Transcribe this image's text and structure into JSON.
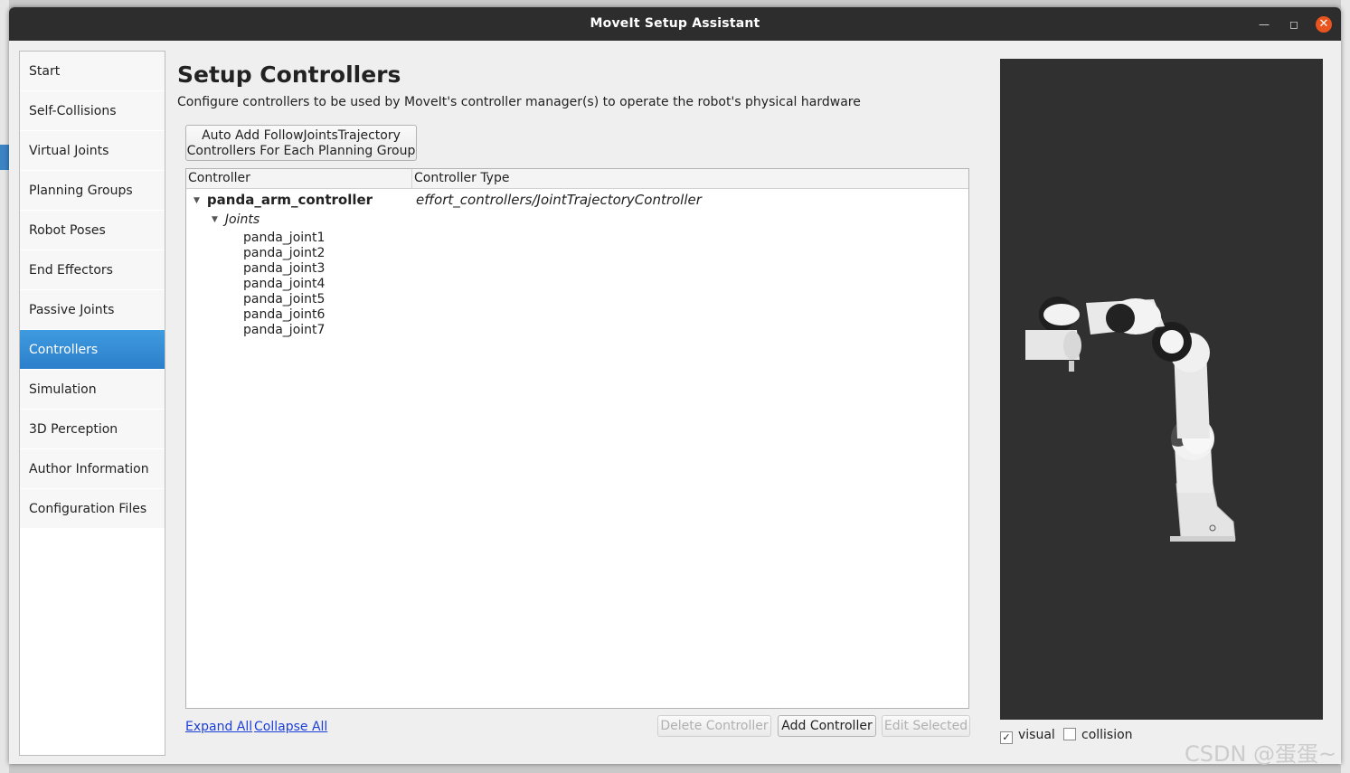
{
  "window": {
    "title": "MoveIt Setup Assistant"
  },
  "titlebar_icons": {
    "minimize": "minimize-icon",
    "maximize": "maximize-icon",
    "close": "close-icon"
  },
  "sidebar": {
    "items": [
      {
        "label": "Start"
      },
      {
        "label": "Self-Collisions"
      },
      {
        "label": "Virtual Joints"
      },
      {
        "label": "Planning Groups"
      },
      {
        "label": "Robot Poses"
      },
      {
        "label": "End Effectors"
      },
      {
        "label": "Passive Joints"
      },
      {
        "label": "Controllers"
      },
      {
        "label": "Simulation"
      },
      {
        "label": "3D Perception"
      },
      {
        "label": "Author Information"
      },
      {
        "label": "Configuration Files"
      }
    ],
    "active": "Controllers"
  },
  "main": {
    "title": "Setup Controllers",
    "description": "Configure controllers to be used by MoveIt's controller manager(s) to operate the robot's physical hardware",
    "auto_add_button": {
      "line1": "Auto Add FollowJointsTrajectory",
      "line2": "Controllers For Each Planning Group"
    },
    "tree": {
      "columns": [
        "Controller",
        "Controller Type"
      ],
      "controller": {
        "name": "panda_arm_controller",
        "type": "effort_controllers/JointTrajectoryController"
      },
      "joints_label": "Joints",
      "joints": [
        "panda_joint1",
        "panda_joint2",
        "panda_joint3",
        "panda_joint4",
        "panda_joint5",
        "panda_joint6",
        "panda_joint7"
      ]
    },
    "links": {
      "expand_all": "Expand All",
      "collapse_all": "Collapse All"
    },
    "buttons": {
      "delete": "Delete Controller",
      "add": "Add Controller",
      "edit": "Edit Selected"
    }
  },
  "viewer": {
    "visual_label": "visual",
    "visual_checked": true,
    "collision_label": "collision",
    "collision_checked": false,
    "background_color": "#303030"
  },
  "watermark": "CSDN @蛋蛋~"
}
